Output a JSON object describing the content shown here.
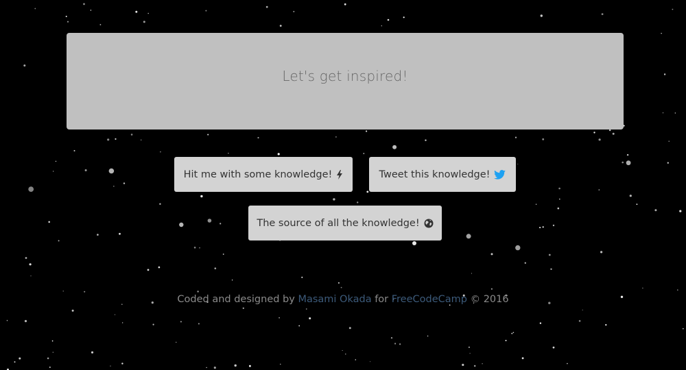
{
  "quote": {
    "text": "Let's get inspired!"
  },
  "buttons": {
    "knowledge_label": "Hit me with some knowledge!",
    "tweet_label": "Tweet this knowledge!",
    "source_label": "The source of all the knowledge!"
  },
  "icons": {
    "knowledge": "lightning-bolt-icon",
    "tweet": "twitter-bird-icon",
    "source": "globe-icon"
  },
  "footer": {
    "prefix": "Coded and designed by",
    "author": "Masami Okada",
    "middle": "for",
    "org": "FreeCodeCamp",
    "suffix": "© 2016"
  },
  "colors": {
    "background": "#000000",
    "quote_box": "#c0c0c0",
    "button": "#d3d3d3",
    "twitter_blue": "#1da1f2",
    "footer_text": "#8a8a8a",
    "footer_link": "#3c5a7a"
  }
}
